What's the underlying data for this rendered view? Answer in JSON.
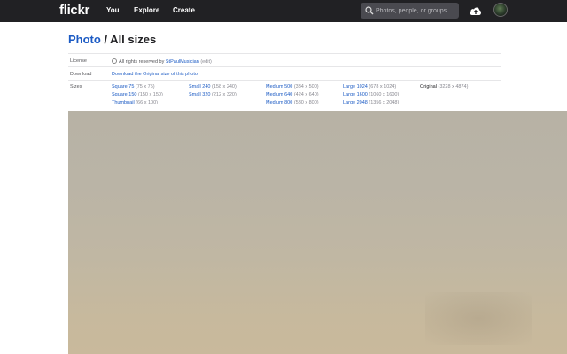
{
  "nav": {
    "logo": "flickr",
    "you": "You",
    "explore": "Explore",
    "create": "Create",
    "search_placeholder": "Photos, people, or groups"
  },
  "title": {
    "link": "Photo",
    "rest": " / All sizes"
  },
  "license": {
    "label": "License",
    "text": "All rights reserved by ",
    "owner": "StPaulMusician",
    "edit": "(edit)"
  },
  "download": {
    "label": "Download",
    "link": "Download the Original size of this photo"
  },
  "sizes": {
    "label": "Sizes",
    "items": [
      {
        "name": "Square 75",
        "dim": "(75 x 75)"
      },
      {
        "name": "Square 150",
        "dim": "(150 x 150)"
      },
      {
        "name": "Thumbnail",
        "dim": "(66 x 100)"
      },
      {
        "name": "Small 240",
        "dim": "(158 x 240)"
      },
      {
        "name": "Small 320",
        "dim": "(212 x 320)"
      },
      {
        "name": "Medium 500",
        "dim": "(334 x 500)"
      },
      {
        "name": "Medium 640",
        "dim": "(424 x 640)"
      },
      {
        "name": "Medium 800",
        "dim": "(530 x 800)"
      },
      {
        "name": "Large 1024",
        "dim": "(678 x 1024)"
      },
      {
        "name": "Large 1600",
        "dim": "(1060 x 1600)"
      },
      {
        "name": "Large 2048",
        "dim": "(1356 x 2048)"
      },
      {
        "name": "Original",
        "dim": "(3228 x 4874)"
      }
    ]
  }
}
